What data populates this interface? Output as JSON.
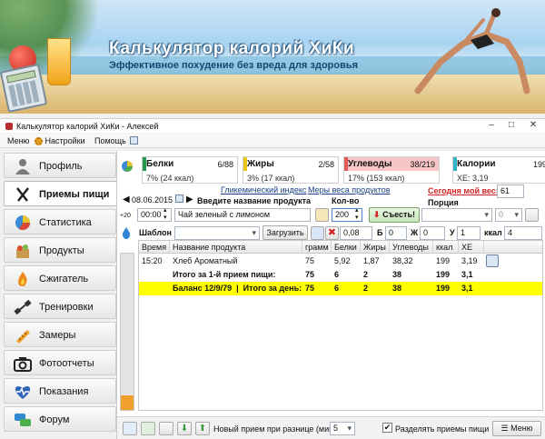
{
  "banner": {
    "title": "Калькулятор калорий ХиКи",
    "subtitle": "Эффективное похудение без вреда для здоровья"
  },
  "window": {
    "title": "Калькулятор калорий ХиКи - Алексей",
    "controls": {
      "minimize": "–",
      "maximize": "□",
      "close": "✕"
    }
  },
  "menu": {
    "items": [
      "Меню",
      "Настройки",
      "Помощь"
    ]
  },
  "sidebar": {
    "items": [
      {
        "label": "Профиль",
        "icon": "person-icon"
      },
      {
        "label": "Приемы пищи",
        "icon": "fork-knife-icon",
        "active": true
      },
      {
        "label": "Статистика",
        "icon": "pie-chart-icon"
      },
      {
        "label": "Продукты",
        "icon": "grocery-bag-icon"
      },
      {
        "label": "Сжигатель",
        "icon": "flame-icon"
      },
      {
        "label": "Тренировки",
        "icon": "dumbbell-icon"
      },
      {
        "label": "Замеры",
        "icon": "measuring-tape-icon"
      },
      {
        "label": "Фотоотчеты",
        "icon": "camera-icon"
      },
      {
        "label": "Показания",
        "icon": "heart-pulse-icon"
      },
      {
        "label": "Форум",
        "icon": "chat-bubbles-icon"
      }
    ]
  },
  "macros": [
    {
      "name": "Белки",
      "count": "6/88",
      "pct": "7% (24 ккал)",
      "color": "#1f9a4a"
    },
    {
      "name": "Жиры",
      "count": "2/58",
      "pct": "3% (17 ккал)",
      "color": "#e8c619"
    },
    {
      "name": "Углеводы",
      "count": "38/219",
      "pct": "17% (153 ккал)",
      "color": "#e05a5a"
    },
    {
      "name": "Калории",
      "count": "199",
      "pct": "ХЕ: 3,19",
      "color": "#2fb3c7"
    }
  ],
  "entry": {
    "date": "08.06.2015",
    "links": {
      "glycemic": "Гликемический индекс",
      "measures": "Меры веса продуктов"
    },
    "today_weight_label": "Сегодня мой вес:",
    "today_weight_value": "61",
    "product_label": "Введите название продукта",
    "qty_label": "Кол-во",
    "portion_label": "Порция",
    "time": "00:00",
    "time_badge": "+20",
    "product_value": "Чай зеленый с лимоном",
    "qty_value": "200",
    "eat_button": "Съесть!",
    "portion_count": "0",
    "template_label": "Шаблон",
    "load_button": "Загрузить",
    "xe_value": "0,08",
    "b_label": "Б",
    "b_value": "0",
    "zh_label": "Ж",
    "zh_value": "0",
    "u_label": "У",
    "u_value": "1",
    "kcal_label": "ккал",
    "kcal_value": "4"
  },
  "table": {
    "headers": [
      "Время",
      "Название продукта",
      "грамм",
      "Белки",
      "Жиры",
      "Углеводы",
      "ккал",
      "ХЕ"
    ],
    "rows": [
      {
        "time": "15:20",
        "name": "Хлеб Ароматный",
        "grams": "75",
        "protein": "5,92",
        "fat": "1,87",
        "carbs": "38,32",
        "kcal": "199",
        "xe": "3,19"
      }
    ],
    "subtotal": {
      "name": "Итого за 1-й прием пищи:",
      "grams": "75",
      "protein": "6",
      "fat": "2",
      "carbs": "38",
      "kcal": "199",
      "xe": "3,1"
    },
    "balance": {
      "name": "Баланс 12/9/79  |  Итого за день:",
      "grams": "75",
      "protein": "6",
      "fat": "2",
      "carbs": "38",
      "kcal": "199",
      "xe": "3,1"
    }
  },
  "bottom": {
    "new_meal_label": "Новый прием при разнице (мин)",
    "new_meal_value": "5",
    "separate_label": "Разделять приемы пищи",
    "separate_checked": true,
    "menu_button": "Меню"
  }
}
